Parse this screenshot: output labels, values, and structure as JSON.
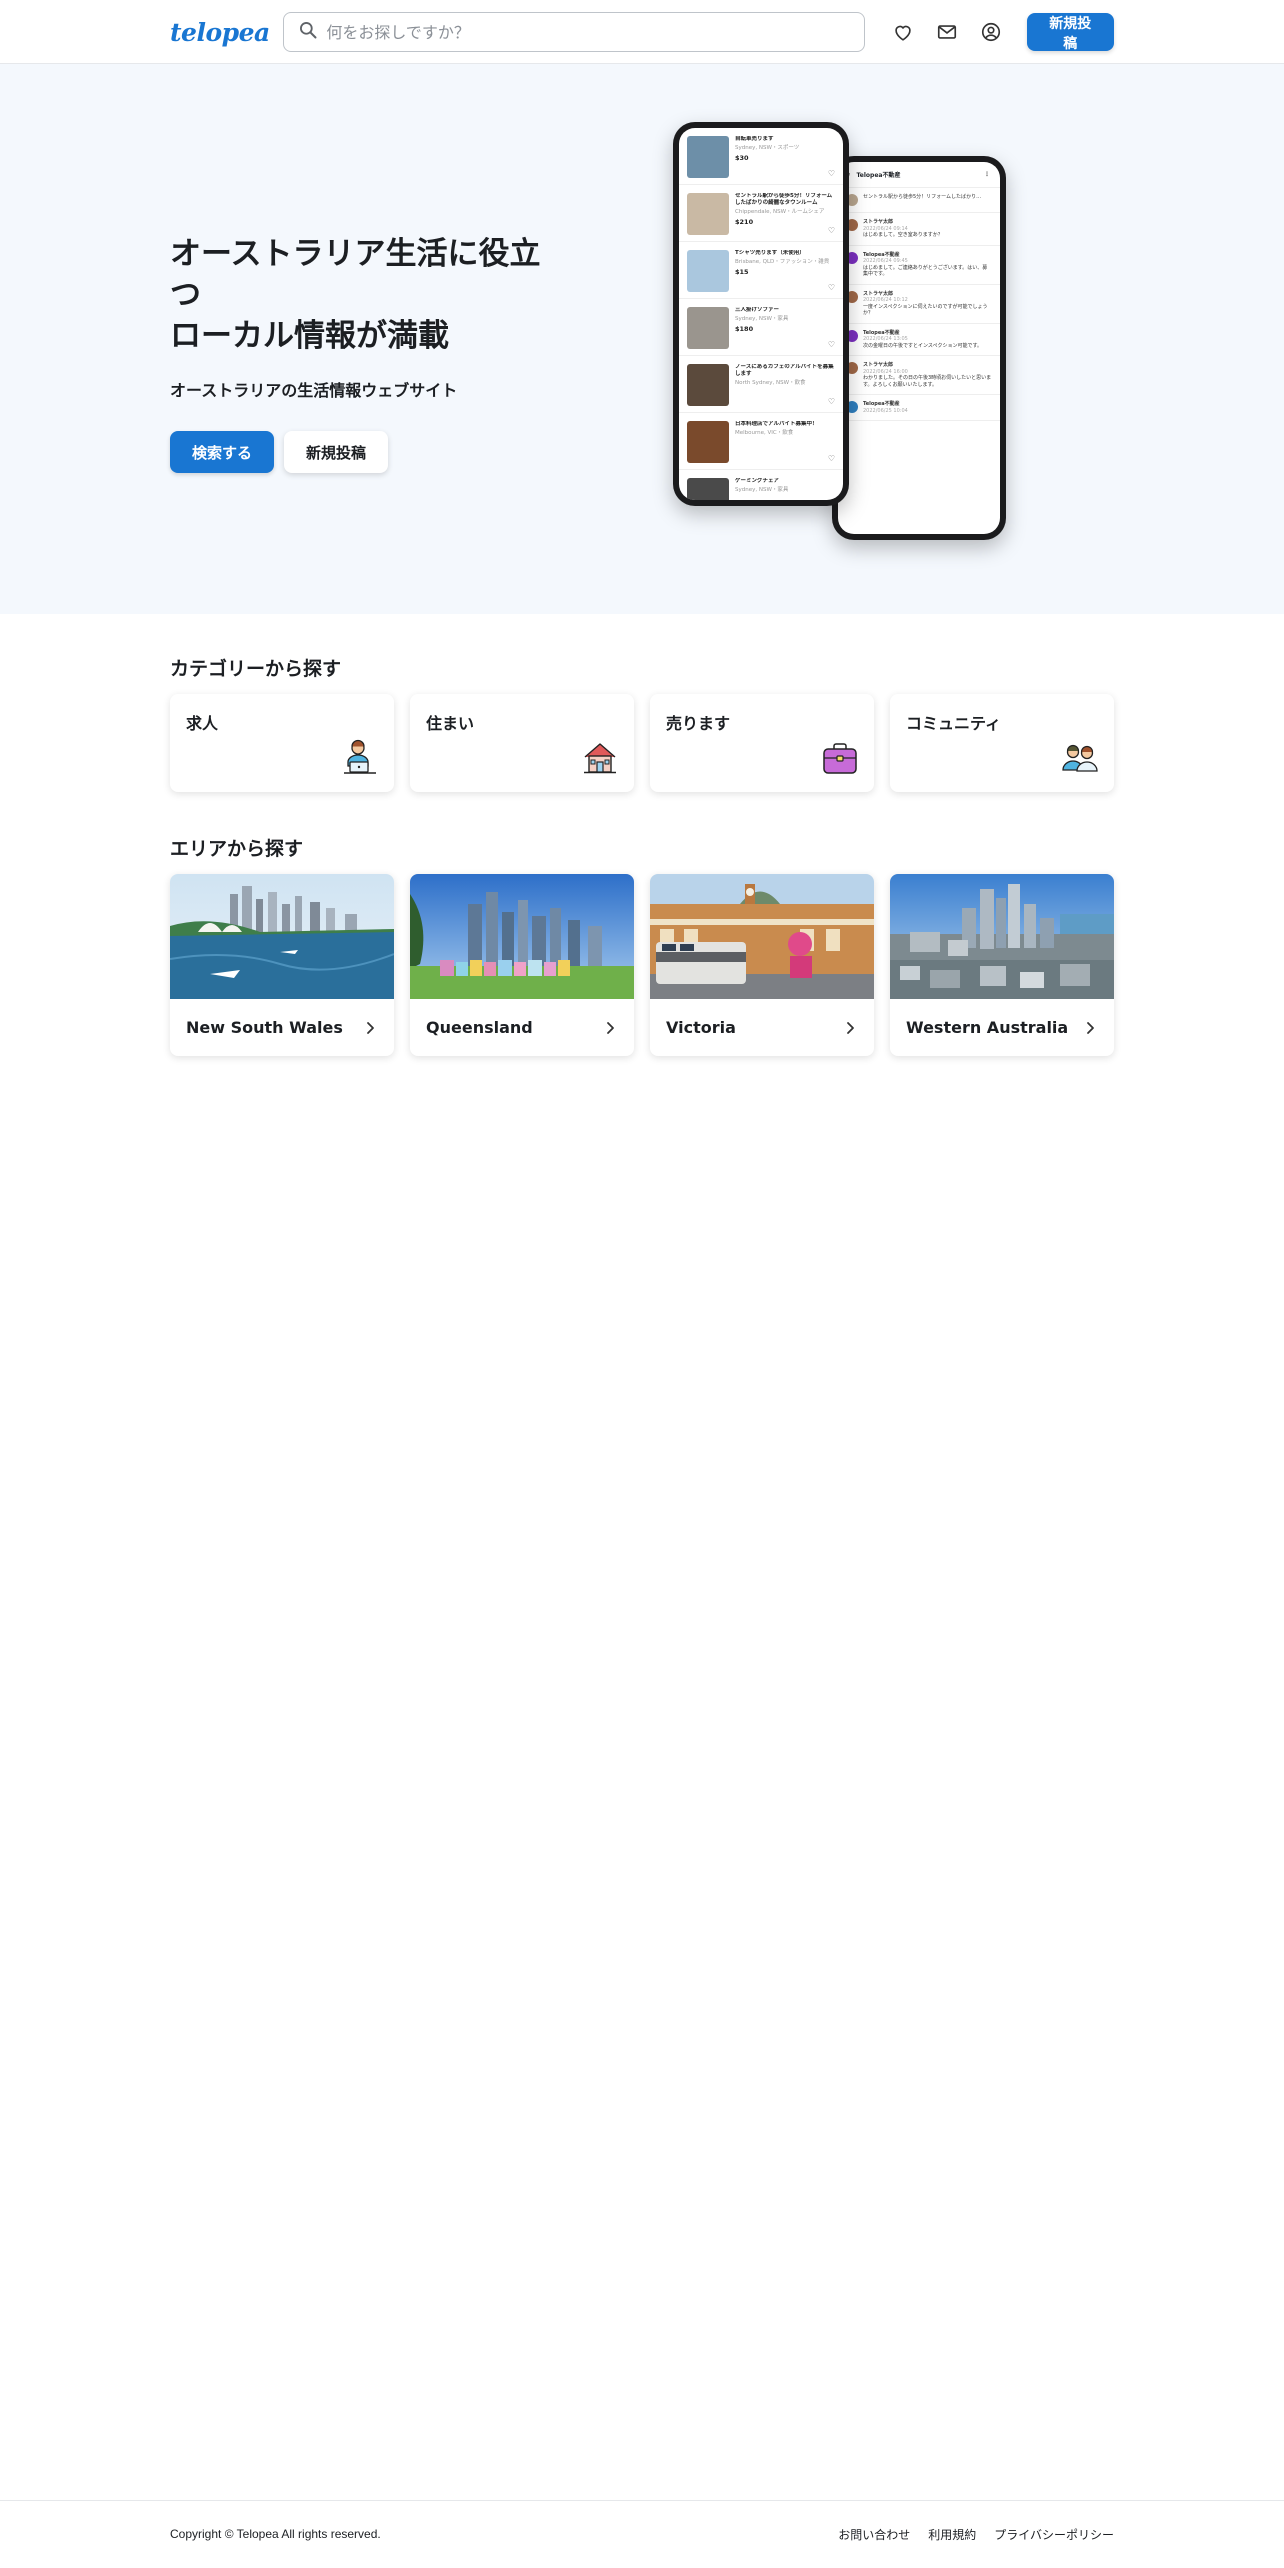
{
  "header": {
    "logo": "telopea",
    "search_placeholder": "何をお探しですか？",
    "post_button": "新規投稿"
  },
  "hero": {
    "title": "オーストラリア生活に役立つ\nローカル情報が満載",
    "subtitle": "オーストラリアの生活情報ウェブサイト",
    "search_button": "検索する",
    "post_button": "新規投稿",
    "phone_listings": [
      {
        "title": "自転車売ります",
        "loc": "Sydney, NSW・スポーツ",
        "price": "$30"
      },
      {
        "title": "セントラル駅から徒歩5分！リフォームしたばかりの綺麗なタウンルーム",
        "loc": "Chippendale, NSW・ルームシェア",
        "price": "$210"
      },
      {
        "title": "Tシャツ売ります（未使用）",
        "loc": "Brisbane, QLD・ファッション・雑貨",
        "price": "$15"
      },
      {
        "title": "三人掛けソファー",
        "loc": "Sydney, NSW・家具",
        "price": "$180"
      },
      {
        "title": "ノースにあるカフェのアルバイトを募集します",
        "loc": "North Sydney, NSW・飲食",
        "price": ""
      },
      {
        "title": "日本料理店でアルバイト募集中！",
        "loc": "Melbourne, VIC・飲食",
        "price": ""
      },
      {
        "title": "ゲーミングチェア",
        "loc": "Sydney, NSW・家具",
        "price": ""
      }
    ],
    "phone_chat_title": "Telopea不動産",
    "phone_messages": [
      {
        "name": "",
        "date": "",
        "text": "セントラル駅から徒歩5分！リフォームしたばかり…",
        "color": "#b8a58e"
      },
      {
        "name": "ストラヤ太郎",
        "date": "2022/06/24 09:14",
        "text": "はじめまして。空き室ありますか？",
        "color": "#a06848"
      },
      {
        "name": "Telopea不動産",
        "date": "2022/06/24 09:45",
        "text": "はじめまして。ご連絡ありがとうございます。はい、募集中です。",
        "color": "#7b2fbf"
      },
      {
        "name": "ストラヤ太郎",
        "date": "2022/06/24 10:12",
        "text": "一度インスペクションに伺えたいのですが可能でしょうか？",
        "color": "#a06848"
      },
      {
        "name": "Telopea不動産",
        "date": "2022/06/24 13:05",
        "text": "次の金曜日の午後ですとインスペクション可能です。",
        "color": "#7b2fbf"
      },
      {
        "name": "ストラヤ太郎",
        "date": "2022/06/24 16:00",
        "text": "わかりました。その日の午後3時頃お伺いしたいと思います。よろしくお願いいたします。",
        "color": "#a06848"
      },
      {
        "name": "Telopea不動産",
        "date": "2022/06/25 10:04",
        "text": "",
        "color": "#2f7fbf"
      }
    ]
  },
  "categories": {
    "title": "カテゴリーから探す",
    "items": [
      {
        "label": "求人",
        "icon": "job-icon"
      },
      {
        "label": "住まい",
        "icon": "house-icon"
      },
      {
        "label": "売ります",
        "icon": "bag-icon"
      },
      {
        "label": "コミュニティ",
        "icon": "community-icon"
      }
    ]
  },
  "areas": {
    "title": "エリアから探す",
    "items": [
      {
        "name": "New South Wales"
      },
      {
        "name": "Queensland"
      },
      {
        "name": "Victoria"
      },
      {
        "name": "Western Australia"
      }
    ]
  },
  "footer": {
    "copyright": "Copyright © Telopea All rights reserved.",
    "links": [
      "お問い合わせ",
      "利用規約",
      "プライバシーポリシー"
    ]
  },
  "colors": {
    "accent": "#1976d2",
    "hero_bg": "#f4f8fd"
  }
}
